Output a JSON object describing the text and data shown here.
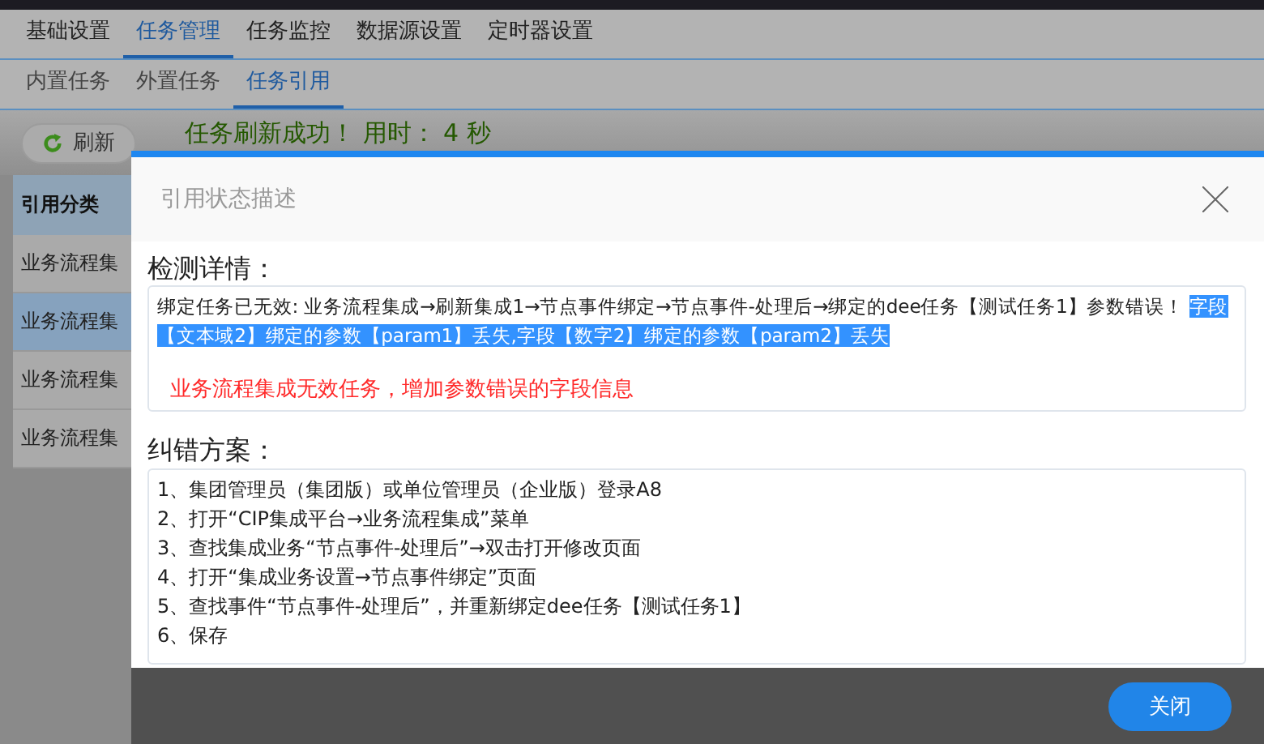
{
  "top_tabs": [
    {
      "label": "基础设置",
      "selected": false
    },
    {
      "label": "任务管理",
      "selected": true
    },
    {
      "label": "任务监控",
      "selected": false
    },
    {
      "label": "数据源设置",
      "selected": false
    },
    {
      "label": "定时器设置",
      "selected": false
    }
  ],
  "sub_tabs": [
    {
      "label": "内置任务",
      "selected": false
    },
    {
      "label": "外置任务",
      "selected": false
    },
    {
      "label": "任务引用",
      "selected": true
    }
  ],
  "toolbar": {
    "refresh_button": "刷新",
    "message": "任务刷新成功！ 用时： 4 秒"
  },
  "sidebar": {
    "header": "引用分类",
    "items": [
      {
        "label": "业务流程集",
        "selected": false
      },
      {
        "label": "业务流程集",
        "selected": true
      },
      {
        "label": "业务流程集",
        "selected": false
      },
      {
        "label": "业务流程集",
        "selected": false
      }
    ]
  },
  "dialog": {
    "title": "引用状态描述",
    "detail_label": "检测详情：",
    "detail_text": "绑定任务已无效: 业务流程集成→刷新集成1→节点事件绑定→节点事件-处理后→绑定的dee任务【测试任务1】参数错误！ ",
    "detail_highlighted": "字段【文本域2】绑定的参数【param1】丢失,字段【数字2】绑定的参数【param2】丢失",
    "detail_note": "业务流程集成无效任务，增加参数错误的字段信息",
    "solution_label": "纠错方案：",
    "steps": [
      "1、集团管理员（集团版）或单位管理员（企业版）登录A8",
      "2、打开“CIP集成平台→业务流程集成”菜单",
      "3、查找集成业务“节点事件-处理后”→双击打开修改页面",
      "4、打开“集成业务设置→节点事件绑定”页面",
      "5、查找事件“节点事件-处理后”，并重新绑定dee任务【测试任务1】",
      "6、保存"
    ],
    "close_button": "关闭"
  }
}
